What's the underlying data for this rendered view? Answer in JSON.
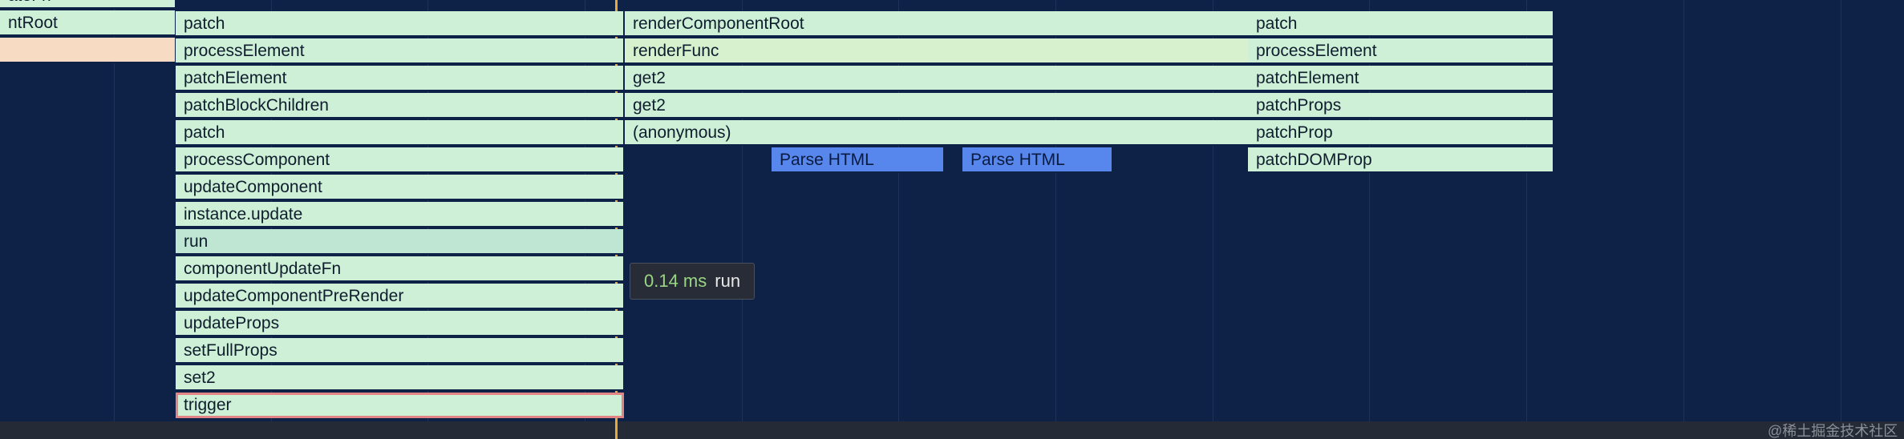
{
  "colors": {
    "background": "#0e2147",
    "frame_green": "#cdf0d6",
    "frame_mint": "#bfe6d2",
    "frame_yellow_green": "#d7f0ce",
    "frame_peach": "#f7dbc3",
    "frame_blue": "#5787ec",
    "selected_border": "#e38585",
    "cursor": "#e8a93a",
    "tooltip_duration": "#9ad785"
  },
  "flame_chart": {
    "columns": [
      {
        "frames": [
          {
            "label": "ateFn",
            "color": "#cdf0d6"
          },
          {
            "label": "ntRoot",
            "color": "#cdf0d6"
          },
          {
            "label": "",
            "color": "#f7dbc3"
          }
        ]
      },
      {
        "frames": [
          {
            "label": "patch",
            "color": "#cdf0d6"
          },
          {
            "label": "processElement",
            "color": "#cdf0d6"
          },
          {
            "label": "patchElement",
            "color": "#cdf0d6"
          },
          {
            "label": "patchBlockChildren",
            "color": "#cdf0d6"
          },
          {
            "label": "patch",
            "color": "#cdf0d6"
          },
          {
            "label": "processComponent",
            "color": "#cdf0d6"
          },
          {
            "label": "updateComponent",
            "color": "#cdf0d6"
          },
          {
            "label": "instance.update",
            "color": "#cdf0d6"
          },
          {
            "label": "run",
            "color": "#bfe6d2",
            "hovered": true
          },
          {
            "label": "componentUpdateFn",
            "color": "#cdf0d6"
          },
          {
            "label": "updateComponentPreRender",
            "color": "#cdf0d6"
          },
          {
            "label": "updateProps",
            "color": "#cdf0d6"
          },
          {
            "label": "setFullProps",
            "color": "#cdf0d6"
          },
          {
            "label": "set2",
            "color": "#cdf0d6"
          },
          {
            "label": "trigger",
            "color": "#cdf0d6",
            "selected": true
          }
        ]
      },
      {
        "frames": [
          {
            "label": "renderComponentRoot",
            "color": "#cdf0d6"
          },
          {
            "label": "renderFunc",
            "color": "#d7f0ce"
          },
          {
            "label": "get2",
            "color": "#cdf0d6"
          },
          {
            "label": "get2",
            "color": "#cdf0d6"
          },
          {
            "label": "(anonymous)",
            "color": "#cdf0d6"
          }
        ]
      },
      {
        "frames": [
          {
            "label": "Parse HTML",
            "color": "#5787ec"
          }
        ]
      },
      {
        "frames": [
          {
            "label": "Parse HTML",
            "color": "#5787ec"
          }
        ]
      },
      {
        "frames": [
          {
            "label": "patch",
            "color": "#cdf0d6"
          },
          {
            "label": "processElement",
            "color": "#cdf0d6"
          },
          {
            "label": "patchElement",
            "color": "#cdf0d6"
          },
          {
            "label": "patchProps",
            "color": "#cdf0d6"
          },
          {
            "label": "patchProp",
            "color": "#cdf0d6"
          },
          {
            "label": "patchDOMProp",
            "color": "#cdf0d6"
          }
        ]
      }
    ]
  },
  "tooltip": {
    "duration": "0.14 ms",
    "name": "run"
  },
  "watermark": "@稀土掘金技术社区"
}
